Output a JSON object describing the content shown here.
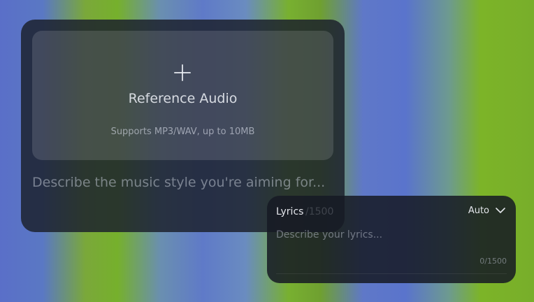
{
  "reference_audio": {
    "title": "Reference Audio",
    "subtitle": "Supports MP3/WAV, up to 10MB",
    "icon": "plus-icon"
  },
  "style_prompt": {
    "placeholder": "Describe the music style you're aiming for...",
    "value": ""
  },
  "lyrics": {
    "label": "Lyrics",
    "ghost_count": "/1500",
    "mode": "Auto",
    "placeholder": "Describe your lyrics...",
    "value": "",
    "char_count": "0/1500"
  },
  "colors": {
    "bg_blue": "#5a74cc",
    "bg_green": "#78b030",
    "card_bg": "#1c202c",
    "text_primary": "#eef0f5"
  }
}
